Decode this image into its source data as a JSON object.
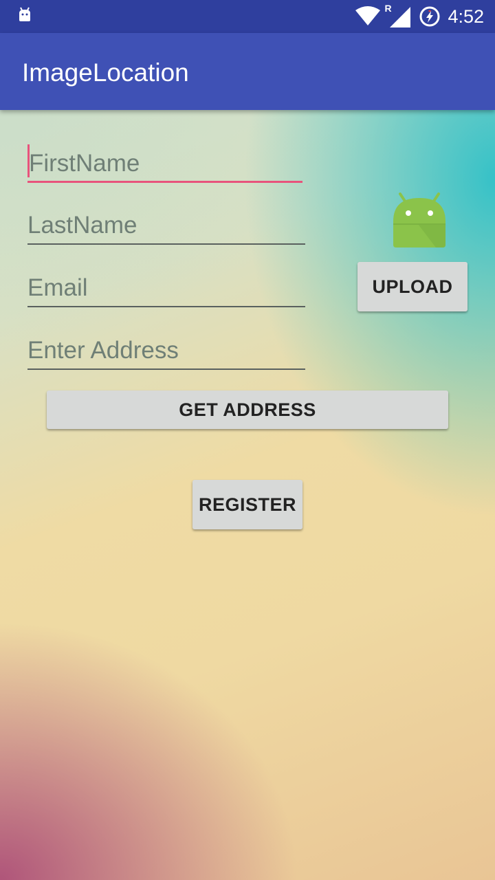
{
  "status_bar": {
    "time": "4:52",
    "network_label": "R",
    "icons": [
      "android-debug-icon",
      "wifi-icon",
      "signal-icon",
      "battery-charging-icon"
    ]
  },
  "app_bar": {
    "title": "ImageLocation",
    "color": "#3f51b5"
  },
  "form": {
    "first_name": {
      "value": "",
      "placeholder": "FirstName"
    },
    "last_name": {
      "value": "",
      "placeholder": "LastName"
    },
    "email": {
      "value": "",
      "placeholder": "Email"
    },
    "address": {
      "value": "",
      "placeholder": "Enter Address"
    }
  },
  "buttons": {
    "upload": "UPLOAD",
    "get_address": "GET ADDRESS",
    "register": "REGISTER"
  },
  "image_preview": {
    "icon": "android-robot-icon"
  },
  "colors": {
    "accent": "#e8537c",
    "status_bar": "#2f3f9e",
    "button": "#d7d9d8"
  }
}
